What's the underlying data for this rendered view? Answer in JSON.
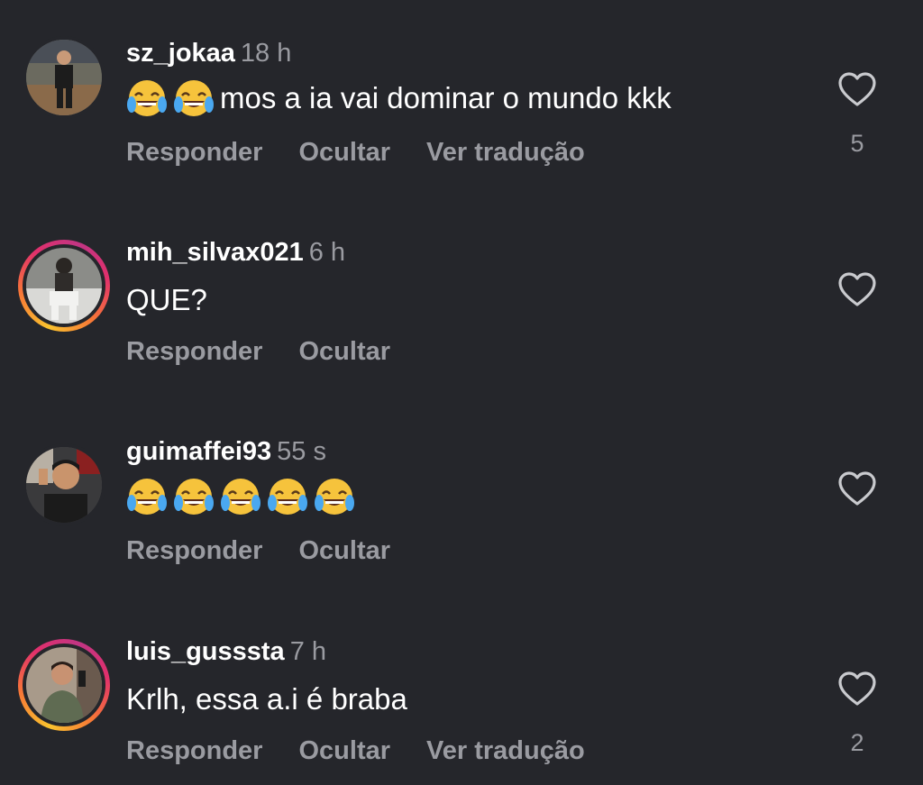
{
  "comments": [
    {
      "username": "sz_jokaa",
      "time": "18 h",
      "emoji_count": 2,
      "text": "mos a ia vai dominar o mundo kkk",
      "actions": [
        "Responder",
        "Ocultar",
        "Ver tradução"
      ],
      "likes": "5",
      "has_story_ring": false
    },
    {
      "username": "mih_silvax021",
      "time": "6 h",
      "emoji_count": 0,
      "text": "QUE?",
      "actions": [
        "Responder",
        "Ocultar"
      ],
      "likes": "",
      "has_story_ring": true
    },
    {
      "username": "guimaffei93",
      "time": "55 s",
      "emoji_count": 5,
      "text": "",
      "actions": [
        "Responder",
        "Ocultar"
      ],
      "likes": "",
      "has_story_ring": false
    },
    {
      "username": "luis_gusssta",
      "time": "7 h",
      "emoji_count": 0,
      "text": "Krlh, essa a.i é braba",
      "actions": [
        "Responder",
        "Ocultar",
        "Ver tradução"
      ],
      "likes": "2",
      "has_story_ring": true
    }
  ],
  "icons": {
    "like": "heart-outline-icon",
    "emoji": "face-with-tears-of-joy"
  },
  "colors": {
    "background": "#25262b",
    "secondary_text": "#9a9ba1",
    "story_ring": "#e1306c"
  }
}
